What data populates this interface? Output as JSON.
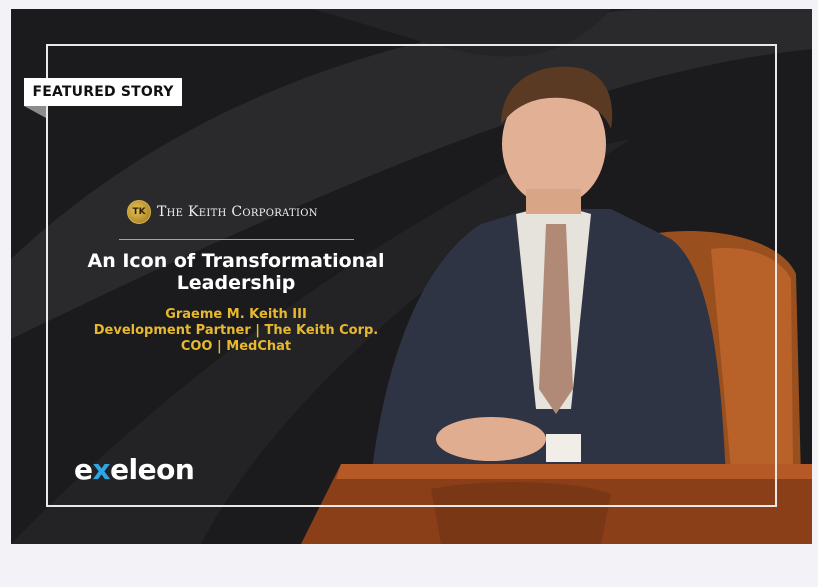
{
  "ribbon": {
    "label": "FEATURED STORY"
  },
  "company": {
    "name": "The Keith Corporation",
    "seal_mark": "TK"
  },
  "headline": {
    "line1": "An Icon of Transformational",
    "line2": "Leadership"
  },
  "subject": {
    "name": "Graeme M. Keith III",
    "role1": "Development Partner | The Keith Corp.",
    "role2": "COO | MedChat"
  },
  "brand": {
    "prefix": "e",
    "x": "x",
    "suffix": "eleon"
  },
  "colors": {
    "background": "#1b1b1d",
    "gold": "#e8b92f",
    "frame": "#e9e9e9",
    "brand_accent": "#2ea6e6"
  }
}
